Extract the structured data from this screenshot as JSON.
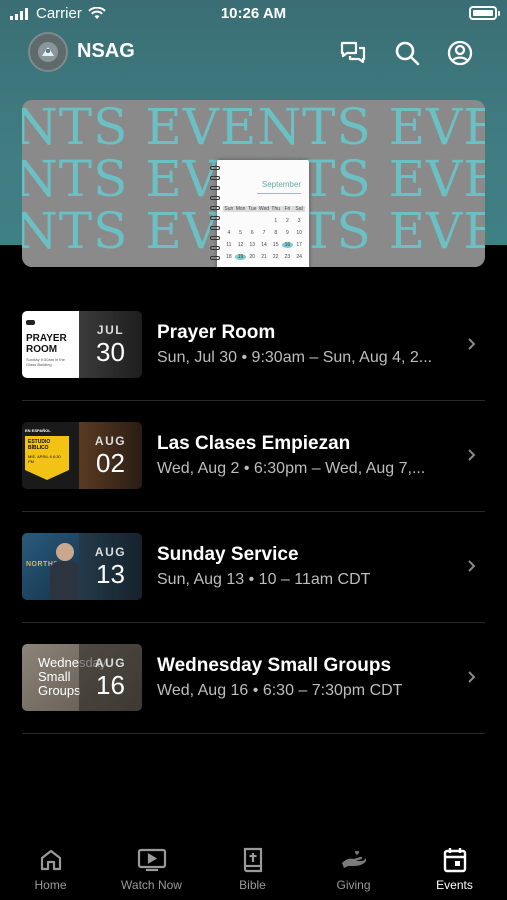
{
  "status_bar": {
    "carrier": "Carrier",
    "time": "10:26 AM"
  },
  "header": {
    "brand": "NSAG"
  },
  "banner": {
    "rows": [
      "NTS EVENTS EVE",
      "NTS EVENTS EVE",
      "NTS EVENTS EVE"
    ],
    "calendar_month": "September",
    "calendar_days": [
      "Sun",
      "Mon",
      "Tue",
      "Wed",
      "Thu",
      "Fri",
      "Sat",
      "",
      "",
      "",
      "",
      "1",
      "2",
      "3",
      "4",
      "5",
      "6",
      "7",
      "8",
      "9",
      "10",
      "11",
      "12",
      "13",
      "14",
      "15",
      "16",
      "17",
      "18",
      "19",
      "20",
      "21",
      "22",
      "23",
      "24"
    ]
  },
  "events": [
    {
      "month": "JUL",
      "day": "30",
      "title": "Prayer Room",
      "subtitle": "Sun, Jul 30 • 9:30am – Sun, Aug 4, 2...",
      "thumb_title": "PRAYER ROOM",
      "thumb_note": "Sunday 9:30am in the Glass Building"
    },
    {
      "month": "AUG",
      "day": "02",
      "title": "Las Clases Empiezan",
      "subtitle": "Wed, Aug 2 • 6:30pm – Wed, Aug 7,...",
      "thumb_tag": "EN ESPAÑOL",
      "thumb_title": "ESTUDIO BÍBLICO",
      "thumb_note": "MIÉ. APRIL 6 6:30 PM"
    },
    {
      "month": "AUG",
      "day": "13",
      "title": "Sunday Service",
      "subtitle": "Sun, Aug 13 • 10 – 11am CDT",
      "thumb_title": "NORTHSIDE"
    },
    {
      "month": "AUG",
      "day": "16",
      "title": "Wednesday Small Groups",
      "subtitle": "Wed, Aug 16 • 6:30 – 7:30pm CDT",
      "thumb_title": "Wednesday Small Groups"
    }
  ],
  "tabs": [
    {
      "label": "Home",
      "icon": "home-icon"
    },
    {
      "label": "Watch Now",
      "icon": "tv-icon"
    },
    {
      "label": "Bible",
      "icon": "bible-icon"
    },
    {
      "label": "Giving",
      "icon": "giving-icon"
    },
    {
      "label": "Events",
      "icon": "calendar-icon",
      "active": true
    }
  ],
  "colors": {
    "accent": "#3f7d82",
    "banner_text": "#6ac3c8"
  }
}
